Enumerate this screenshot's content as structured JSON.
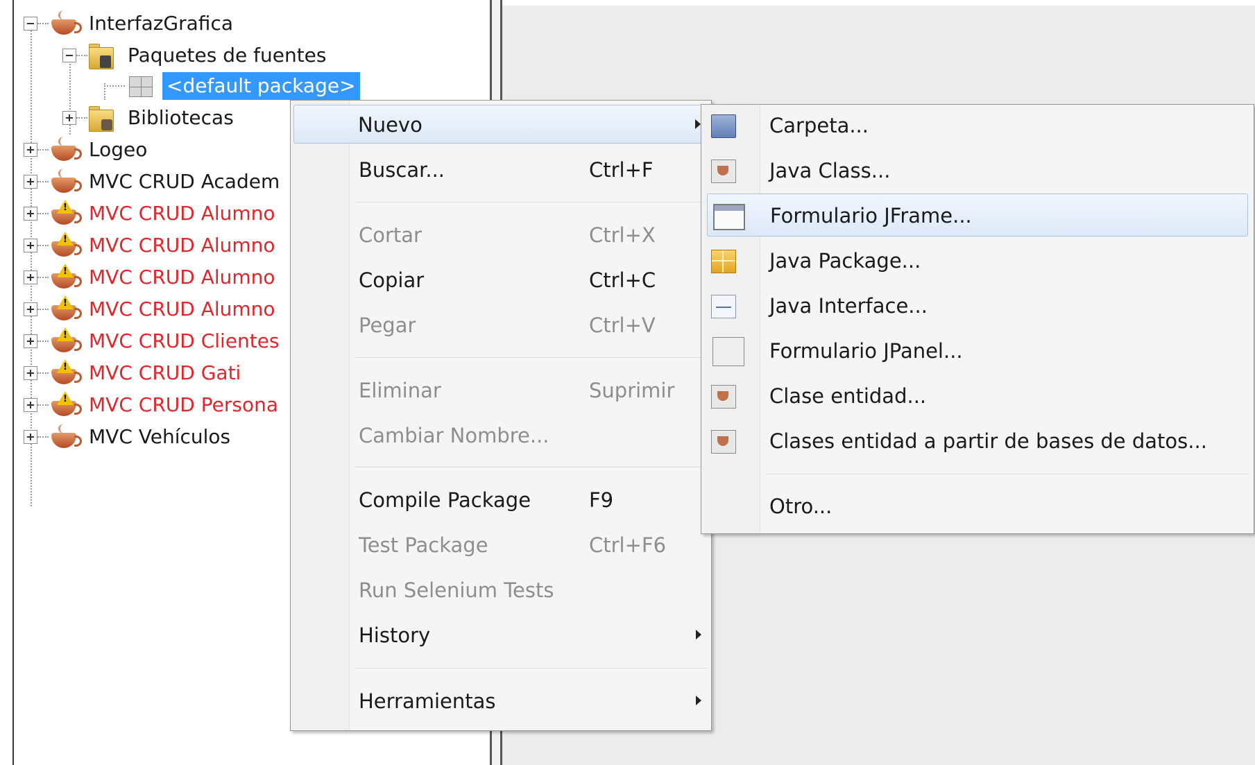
{
  "tree": {
    "project": "InterfazGrafica",
    "source_packages": "Paquetes de fuentes",
    "default_package": "<default package>",
    "libraries": "Bibliotecas",
    "items": [
      {
        "label": "Logeo",
        "error": false
      },
      {
        "label": "MVC CRUD Academ",
        "error": false
      },
      {
        "label": "MVC CRUD Alumno",
        "error": true
      },
      {
        "label": "MVC CRUD Alumno",
        "error": true
      },
      {
        "label": "MVC CRUD Alumno",
        "error": true
      },
      {
        "label": "MVC CRUD Alumno",
        "error": true
      },
      {
        "label": "MVC CRUD Clientes",
        "error": true
      },
      {
        "label": "MVC CRUD Gati",
        "error": true
      },
      {
        "label": "MVC CRUD Persona",
        "error": true
      },
      {
        "label": "MVC Vehículos",
        "error": false
      }
    ]
  },
  "context_menu": {
    "nuevo": "Nuevo",
    "buscar": {
      "label": "Buscar...",
      "shortcut": "Ctrl+F"
    },
    "cortar": {
      "label": "Cortar",
      "shortcut": "Ctrl+X"
    },
    "copiar": {
      "label": "Copiar",
      "shortcut": "Ctrl+C"
    },
    "pegar": {
      "label": "Pegar",
      "shortcut": "Ctrl+V"
    },
    "eliminar": {
      "label": "Eliminar",
      "shortcut": "Suprimir"
    },
    "cambiar_nombre": "Cambiar Nombre...",
    "compile_package": {
      "label": "Compile Package",
      "shortcut": "F9"
    },
    "test_package": {
      "label": "Test Package",
      "shortcut": "Ctrl+F6"
    },
    "run_selenium": "Run Selenium Tests",
    "history": "History",
    "herramientas": "Herramientas"
  },
  "submenu": {
    "carpeta": "Carpeta...",
    "java_class": "Java Class...",
    "formulario_jframe": "Formulario JFrame...",
    "java_package": "Java Package...",
    "java_interface": "Java Interface...",
    "formulario_jpanel": "Formulario JPanel...",
    "clase_entidad": "Clase entidad...",
    "clases_entidad_bd": "Clases entidad a partir de bases de datos...",
    "otro": "Otro..."
  }
}
